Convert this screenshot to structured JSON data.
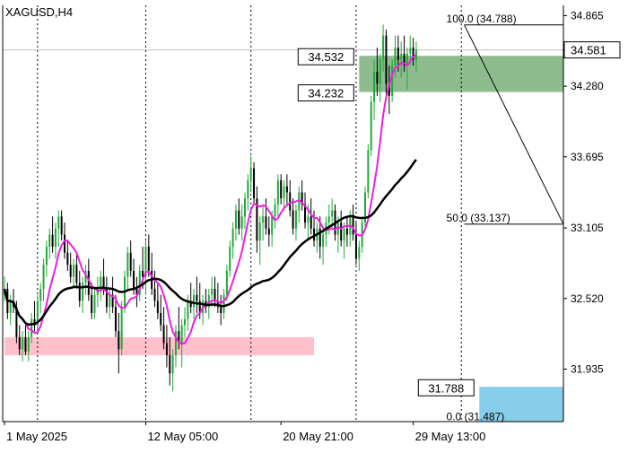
{
  "chart_data": {
    "type": "candlestick",
    "symbol": "XAGUSD",
    "timeframe": "H4",
    "title": "XAGUSD,H4",
    "ylim": [
      31.5,
      34.95
    ],
    "y_ticks": [
      "34.865",
      "34.280",
      "33.695",
      "33.105",
      "32.520",
      "31.935"
    ],
    "x_ticks": [
      {
        "label": "1 May 2025",
        "bar": 0
      },
      {
        "label": "12 May 05:00",
        "bar": 47
      },
      {
        "label": "20 May 21:00",
        "bar": 92
      },
      {
        "label": "29 May 13:00",
        "bar": 136
      }
    ],
    "period_separators_bar": [
      11,
      47,
      82,
      117,
      152
    ],
    "current_price": 34.581,
    "current_price_label": "34.581",
    "fibonacci": {
      "start": {
        "bar": 153,
        "price": 34.788
      },
      "end": {
        "bar": 187,
        "price": 33.137
      },
      "levels": [
        {
          "label": "100.0 (34.788)",
          "price": 34.788
        },
        {
          "label": "50.0 (33.137)",
          "price": 33.137
        },
        {
          "label": "0.0 (31.487)",
          "price": 31.487
        }
      ]
    },
    "zones": [
      {
        "name": "resistance",
        "top": 34.532,
        "bottom": 34.232,
        "color": "#8fbc8f",
        "from_bar": 118,
        "to_bar": 187,
        "labels": [
          "34.532",
          "34.232"
        ]
      },
      {
        "name": "support",
        "top": 32.2,
        "bottom": 32.05,
        "color": "#ffc0cb",
        "from_bar": 0,
        "to_bar": 103
      },
      {
        "name": "target",
        "top": 31.788,
        "bottom": 31.5,
        "color": "#87ceeb",
        "from_bar": 158,
        "to_bar": 187,
        "labels": [
          "31.788"
        ]
      }
    ],
    "series_ohlc": [
      {
        "x": "2025-05-01",
        "values": [
          [
            32.55,
            32.7,
            32.5,
            32.6
          ],
          [
            32.6,
            32.65,
            32.35,
            32.4
          ],
          [
            32.4,
            32.55,
            32.3,
            32.5
          ],
          [
            32.5,
            32.6,
            32.4,
            32.45
          ],
          [
            32.45,
            32.5,
            32.15,
            32.2
          ],
          [
            32.2,
            32.3,
            32.05,
            32.1
          ],
          [
            32.1,
            32.25,
            32.0,
            32.2
          ],
          [
            32.2,
            32.3,
            32.05,
            32.08
          ],
          [
            32.08,
            32.25,
            32.0,
            32.2
          ],
          [
            32.2,
            32.4,
            32.15,
            32.35
          ],
          [
            32.35,
            32.5,
            32.25,
            32.3
          ],
          [
            32.3,
            32.55,
            32.25,
            32.5
          ],
          [
            32.5,
            32.65,
            32.4,
            32.6
          ],
          [
            32.6,
            32.85,
            32.5,
            32.8
          ],
          [
            32.8,
            33.0,
            32.7,
            32.95
          ],
          [
            32.95,
            33.1,
            32.85,
            33.05
          ],
          [
            33.05,
            33.2,
            32.9,
            32.95
          ],
          [
            32.95,
            33.15,
            32.85,
            33.1
          ],
          [
            33.1,
            33.25,
            32.95,
            33.2
          ],
          [
            33.2,
            33.25,
            33.0,
            33.05
          ],
          [
            33.05,
            33.15,
            32.85,
            32.9
          ],
          [
            32.9,
            33.0,
            32.75,
            32.8
          ],
          [
            32.8,
            32.9,
            32.65,
            32.7
          ],
          [
            32.7,
            32.85,
            32.6,
            32.8
          ],
          [
            32.8,
            32.9,
            32.6,
            32.65
          ],
          [
            32.65,
            32.75,
            32.45,
            32.5
          ],
          [
            32.5,
            32.7,
            32.4,
            32.65
          ],
          [
            32.65,
            32.8,
            32.55,
            32.75
          ],
          [
            32.75,
            32.85,
            32.5,
            32.55
          ],
          [
            32.55,
            32.65,
            32.35,
            32.4
          ],
          [
            32.4,
            32.6,
            32.35,
            32.55
          ],
          [
            32.55,
            32.7,
            32.45,
            32.6
          ],
          [
            32.6,
            32.75,
            32.5,
            32.7
          ],
          [
            32.7,
            32.85,
            32.55,
            32.6
          ],
          [
            32.6,
            32.7,
            32.4,
            32.45
          ],
          [
            32.45,
            32.6,
            32.35,
            32.55
          ],
          [
            32.55,
            32.7,
            32.4,
            32.45
          ],
          [
            32.45,
            32.55,
            32.2,
            32.25
          ],
          [
            32.25,
            32.4,
            31.9,
            32.1
          ],
          [
            32.1,
            32.5,
            32.05,
            32.45
          ],
          [
            32.45,
            32.75,
            32.4,
            32.7
          ],
          [
            32.7,
            32.95,
            32.6,
            32.9
          ],
          [
            32.9,
            33.0,
            32.7,
            32.75
          ],
          [
            32.75,
            32.85,
            32.55,
            32.6
          ],
          [
            32.6,
            32.7,
            32.45,
            32.55
          ],
          [
            32.55,
            32.8,
            32.5,
            32.75
          ],
          [
            32.75,
            32.95,
            32.6,
            32.7
          ],
          [
            32.7,
            33.0,
            32.55,
            32.95
          ],
          [
            32.95,
            33.05,
            32.7,
            32.75
          ],
          [
            32.75,
            32.9,
            32.55,
            32.6
          ],
          [
            32.6,
            32.75,
            32.45,
            32.5
          ],
          [
            32.5,
            32.65,
            32.35,
            32.4
          ],
          [
            32.4,
            32.55,
            32.25,
            32.3
          ],
          [
            32.3,
            32.45,
            32.1,
            32.15
          ],
          [
            32.15,
            32.3,
            31.95,
            32.05
          ],
          [
            32.05,
            32.2,
            31.8,
            31.9
          ],
          [
            31.9,
            32.1,
            31.75,
            32.05
          ],
          [
            32.05,
            32.3,
            31.95,
            32.25
          ],
          [
            32.25,
            32.45,
            32.1,
            32.15
          ],
          [
            32.15,
            32.35,
            31.95,
            32.3
          ],
          [
            32.3,
            32.45,
            32.2,
            32.35
          ],
          [
            32.35,
            32.55,
            32.25,
            32.5
          ],
          [
            32.5,
            32.65,
            32.4,
            32.45
          ],
          [
            32.45,
            32.6,
            32.35,
            32.55
          ],
          [
            32.55,
            32.7,
            32.4,
            32.5
          ],
          [
            32.5,
            32.65,
            32.35,
            32.4
          ],
          [
            32.4,
            32.55,
            32.3,
            32.5
          ],
          [
            32.5,
            32.6,
            32.4,
            32.45
          ],
          [
            32.45,
            32.6,
            32.35,
            32.55
          ],
          [
            32.55,
            32.7,
            32.45,
            32.6
          ],
          [
            32.6,
            32.7,
            32.45,
            32.5
          ],
          [
            32.5,
            32.65,
            32.4,
            32.45
          ],
          [
            32.45,
            32.55,
            32.3,
            32.4
          ],
          [
            32.4,
            32.6,
            32.35,
            32.55
          ],
          [
            32.55,
            32.8,
            32.5,
            32.75
          ],
          [
            32.75,
            33.0,
            32.7,
            32.95
          ],
          [
            32.95,
            33.15,
            32.85,
            33.1
          ],
          [
            33.1,
            33.3,
            33.0,
            33.25
          ],
          [
            33.25,
            33.35,
            33.05,
            33.1
          ],
          [
            33.1,
            33.3,
            33.0,
            33.2
          ],
          [
            33.2,
            33.4,
            33.1,
            33.35
          ],
          [
            33.35,
            33.55,
            33.25,
            33.5
          ],
          [
            33.5,
            33.7,
            33.4,
            33.6
          ],
          [
            33.6,
            33.65,
            33.3,
            33.35
          ],
          [
            33.35,
            33.45,
            32.9,
            33.0
          ],
          [
            33.0,
            33.2,
            32.8,
            33.15
          ],
          [
            33.15,
            33.3,
            33.0,
            33.2
          ],
          [
            33.2,
            33.35,
            33.05,
            33.1
          ],
          [
            33.1,
            33.2,
            32.95,
            33.05
          ],
          [
            33.05,
            33.25,
            32.95,
            33.2
          ],
          [
            33.2,
            33.35,
            33.1,
            33.3
          ],
          [
            33.3,
            33.55,
            33.2,
            33.5
          ],
          [
            33.5,
            33.55,
            33.3,
            33.35
          ],
          [
            33.35,
            33.5,
            33.25,
            33.45
          ],
          [
            33.45,
            33.55,
            33.3,
            33.4
          ],
          [
            33.4,
            33.5,
            33.2,
            33.25
          ],
          [
            33.25,
            33.35,
            33.05,
            33.1
          ],
          [
            33.1,
            33.3,
            33.0,
            33.25
          ],
          [
            33.25,
            33.45,
            33.15,
            33.4
          ],
          [
            33.4,
            33.5,
            33.25,
            33.3
          ],
          [
            33.3,
            33.4,
            33.1,
            33.15
          ],
          [
            33.15,
            33.3,
            33.0,
            33.2
          ],
          [
            33.2,
            33.35,
            33.05,
            33.1
          ],
          [
            33.1,
            33.25,
            32.95,
            33.0
          ],
          [
            33.0,
            33.15,
            32.9,
            33.1
          ],
          [
            33.1,
            33.2,
            32.85,
            32.95
          ],
          [
            32.95,
            33.1,
            32.8,
            33.05
          ],
          [
            33.05,
            33.2,
            32.95,
            33.15
          ],
          [
            33.15,
            33.3,
            33.05,
            33.2
          ],
          [
            33.2,
            33.35,
            33.1,
            33.25
          ],
          [
            33.25,
            33.3,
            33.0,
            33.05
          ],
          [
            33.05,
            33.2,
            32.9,
            33.15
          ],
          [
            33.15,
            33.25,
            32.95,
            33.0
          ],
          [
            33.0,
            33.15,
            32.85,
            33.1
          ],
          [
            33.1,
            33.2,
            32.95,
            33.05
          ],
          [
            33.05,
            33.25,
            32.95,
            33.2
          ],
          [
            33.2,
            33.3,
            33.0,
            33.05
          ],
          [
            33.05,
            33.15,
            32.8,
            32.85
          ],
          [
            32.85,
            33.0,
            32.75,
            32.95
          ],
          [
            32.95,
            33.2,
            32.9,
            33.15
          ],
          [
            33.15,
            33.45,
            33.1,
            33.4
          ],
          [
            33.4,
            33.8,
            33.35,
            33.75
          ],
          [
            33.75,
            34.2,
            33.7,
            34.15
          ],
          [
            34.15,
            34.5,
            34.0,
            34.4
          ],
          [
            34.4,
            34.6,
            34.2,
            34.3
          ],
          [
            34.3,
            34.55,
            34.15,
            34.5
          ],
          [
            34.5,
            34.79,
            34.4,
            34.7
          ],
          [
            34.7,
            34.75,
            34.2,
            34.3
          ],
          [
            34.3,
            34.45,
            34.05,
            34.2
          ],
          [
            34.2,
            34.5,
            34.15,
            34.45
          ],
          [
            34.45,
            34.7,
            34.35,
            34.6
          ],
          [
            34.6,
            34.7,
            34.4,
            34.5
          ],
          [
            34.5,
            34.65,
            34.35,
            34.55
          ],
          [
            34.55,
            34.7,
            34.4,
            34.45
          ],
          [
            34.45,
            34.6,
            34.25,
            34.55
          ],
          [
            34.55,
            34.7,
            34.45,
            34.6
          ],
          [
            34.6,
            34.68,
            34.45,
            34.5
          ],
          [
            34.5,
            34.65,
            34.4,
            34.58
          ]
        ]
      }
    ],
    "moving_averages": [
      {
        "color": "#ee1fe0",
        "kind": "fast"
      },
      {
        "color": "#000000",
        "kind": "slow"
      }
    ],
    "colors": {
      "bull": "#22a83a",
      "bear": "#000000",
      "grid": "#000000",
      "fib": "#000000",
      "price_line": "#c0c0c0"
    }
  }
}
